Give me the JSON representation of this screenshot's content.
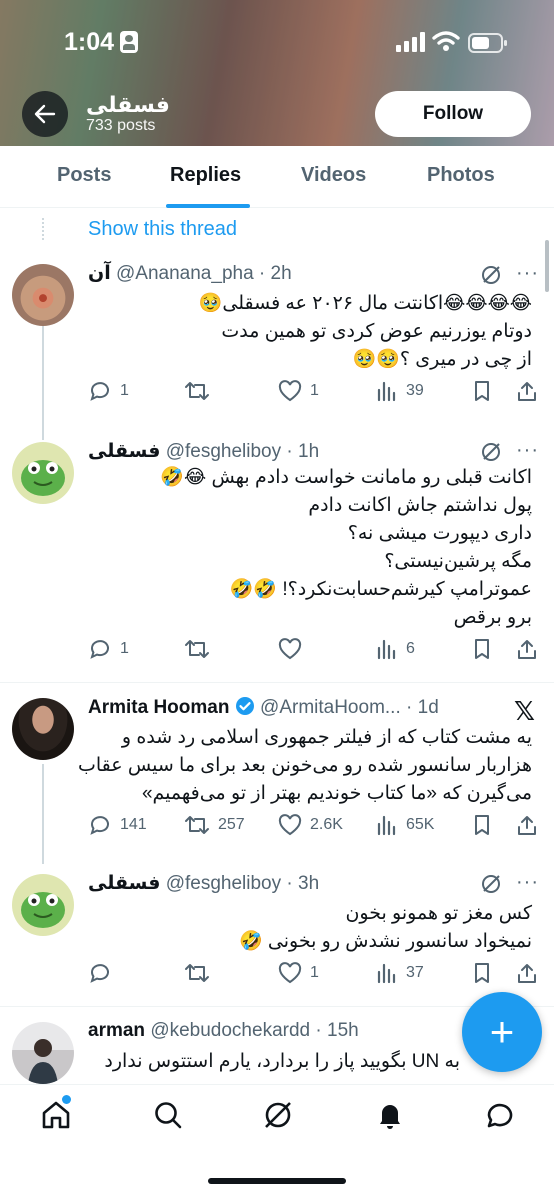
{
  "status": {
    "time": "1:04"
  },
  "header": {
    "name": "فسقلی",
    "post_count": "733 posts",
    "follow_label": "Follow",
    "back_icon": "arrow-left-icon"
  },
  "tabs": [
    {
      "label": "Posts",
      "active": false
    },
    {
      "label": "Replies",
      "active": true
    },
    {
      "label": "Videos",
      "active": false
    },
    {
      "label": "Photos",
      "active": false
    }
  ],
  "show_thread": "Show this thread",
  "tweets": [
    {
      "name": "آن",
      "handle": "@Ananana_pha",
      "time": "2h",
      "lines": [
        "😂😂😂😂اکانتت مال ۲۰۲۶ عه فسقلی🥹",
        "دوتام یوزرنیم عوض کردی تو همین مدت",
        "از چی در میری ؟🥹🥹"
      ],
      "replies": "1",
      "reposts": "",
      "likes": "1",
      "views": "39"
    },
    {
      "name": "فسقلی",
      "handle": "@fesgheliboy",
      "time": "1h",
      "lines": [
        "اکانت قبلی رو مامانت خواست دادم بهش 😂🤣",
        "پول نداشتم جاش اکانت دادم",
        "داری دیپورت میشی نه؟",
        "مگه پرشین‌نیستی؟",
        "عموترامپ کیرشم‌حسابت‌نکرد؟! 🤣🤣",
        "برو برقص"
      ],
      "replies": "1",
      "reposts": "",
      "likes": "",
      "views": "6"
    },
    {
      "name": "Armita Hooman",
      "handle": "@ArmitaHoom...",
      "time": "1d",
      "lines": [
        "یه مشت کتاب که از فیلتر جمهوری اسلامی رد شده و",
        "هزاربار سانسور شده رو می‌خونن بعد برای ما سیس عقاب",
        "می‌گیرن که «ما کتاب خوندیم بهتر از تو می‌فهمیم»"
      ],
      "replies": "141",
      "reposts": "257",
      "likes": "2.6K",
      "views": "65K"
    },
    {
      "name": "فسقلی",
      "handle": "@fesgheliboy",
      "time": "3h",
      "lines": [
        "کس مغز تو همونو بخون",
        "نمیخواد سانسور نشدش رو بخونی 🤣"
      ],
      "replies": "",
      "reposts": "",
      "likes": "1",
      "views": "37"
    },
    {
      "name": "arman",
      "handle": "@kebudochekardd",
      "time": "15h",
      "lines": [
        "به UN بگویید پاز را بردارد، یارم استتوس ندارد"
      ]
    }
  ],
  "colors": {
    "accent": "#1d9bf0",
    "verified": "#1d9bf0",
    "text": "#0f1419",
    "muted": "#536471"
  }
}
